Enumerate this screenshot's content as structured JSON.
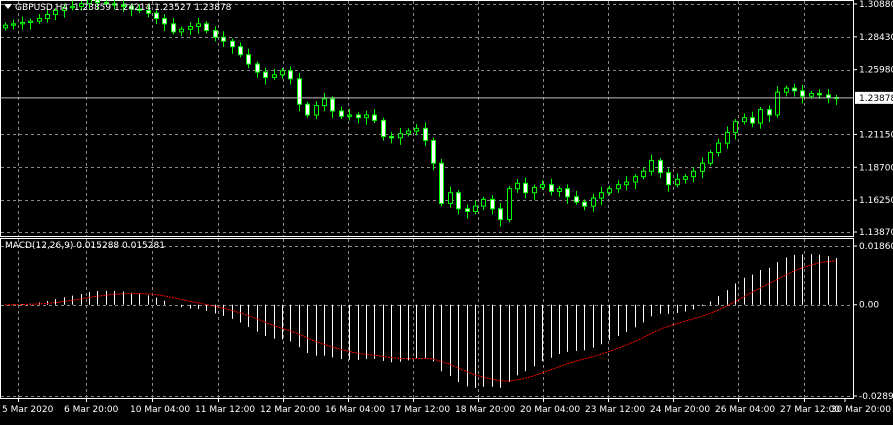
{
  "chart_data": [
    {
      "type": "candlestick",
      "symbol": "GBPUSD,H4",
      "ohlc_readout": [
        "1.23859",
        "1.24214",
        "1.23527",
        "1.23878"
      ],
      "current_price": "1.23878",
      "price_ticks": [
        "1.30880",
        "1.28430",
        "1.25980",
        "1.21150",
        "1.18700",
        "1.16250",
        "1.13870"
      ],
      "ylim": [
        1.1387,
        1.3088
      ],
      "x_ticks": [
        "5 Mar 2020",
        "6 Mar 20:00",
        "10 Mar 04:00",
        "11 Mar 12:00",
        "12 Mar 20:00",
        "16 Mar 04:00",
        "17 Mar 12:00",
        "18 Mar 20:00",
        "20 Mar 04:00",
        "23 Mar 12:00",
        "24 Mar 20:00",
        "26 Mar 04:00",
        "27 Mar 12:00",
        "30 Mar 20:00"
      ],
      "grid": true,
      "candle_color": "#00ff00",
      "close_series": [
        1.293,
        1.294,
        1.295,
        1.296,
        1.298,
        1.301,
        1.304,
        1.306,
        1.307,
        1.309,
        1.312,
        1.31,
        1.309,
        1.308,
        1.307,
        1.305,
        1.304,
        1.302,
        1.298,
        1.294,
        1.288,
        1.29,
        1.292,
        1.294,
        1.289,
        1.284,
        1.281,
        1.277,
        1.271,
        1.264,
        1.258,
        1.254,
        1.256,
        1.259,
        1.253,
        1.234,
        1.226,
        1.233,
        1.238,
        1.229,
        1.225,
        1.226,
        1.224,
        1.226,
        1.222,
        1.21,
        1.209,
        1.212,
        1.214,
        1.216,
        1.207,
        1.19,
        1.16,
        1.168,
        1.156,
        1.154,
        1.158,
        1.163,
        1.156,
        1.148,
        1.171,
        1.175,
        1.168,
        1.172,
        1.174,
        1.169,
        1.171,
        1.165,
        1.161,
        1.158,
        1.164,
        1.168,
        1.171,
        1.174,
        1.176,
        1.18,
        1.184,
        1.192,
        1.183,
        1.174,
        1.178,
        1.18,
        1.184,
        1.19,
        1.198,
        1.205,
        1.213,
        1.221,
        1.224,
        1.22,
        1.23,
        1.226,
        1.243,
        1.246,
        1.244,
        1.24,
        1.242,
        1.241,
        1.239,
        1.2388
      ]
    },
    {
      "type": "histogram+line",
      "label": "MACD(12,26,9) 0.015288 0.015281",
      "y_ticks": [
        "0.018600",
        "0.00",
        "-0.028900"
      ],
      "ylim": [
        -0.0289,
        0.0186
      ],
      "histogram_color": "#ffffff",
      "signal_color": "#ff0000"
    }
  ]
}
